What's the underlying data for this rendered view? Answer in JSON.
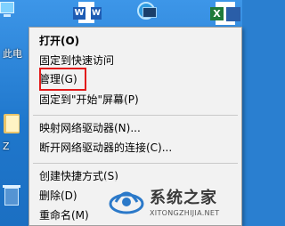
{
  "desktop": {
    "labels": {
      "this_pc": "此电",
      "folder": "Z"
    },
    "icons": [
      "monitor-icon",
      "word-icon",
      "network-icon",
      "excel-icon",
      "folder-icon",
      "recycle-bin-icon"
    ],
    "colors": {
      "background": "#2a7fd0"
    }
  },
  "context_menu": {
    "items": [
      {
        "label": "打开(O)"
      },
      {
        "label": "固定到快速访问"
      },
      {
        "label": "管理(G)"
      },
      {
        "label": "固定到\"开始\"屏幕(P)"
      },
      {
        "label": "映射网络驱动器(N)..."
      },
      {
        "label": "断开网络驱动器的连接(C)..."
      },
      {
        "label": "创建快捷方式(S)"
      },
      {
        "label": "删除(D)"
      },
      {
        "label": "重命名(M)"
      }
    ],
    "highlight_color": "#e21a1a"
  },
  "watermark": {
    "name": "系统之家",
    "url": "XITONGZHIJIA.NET"
  }
}
